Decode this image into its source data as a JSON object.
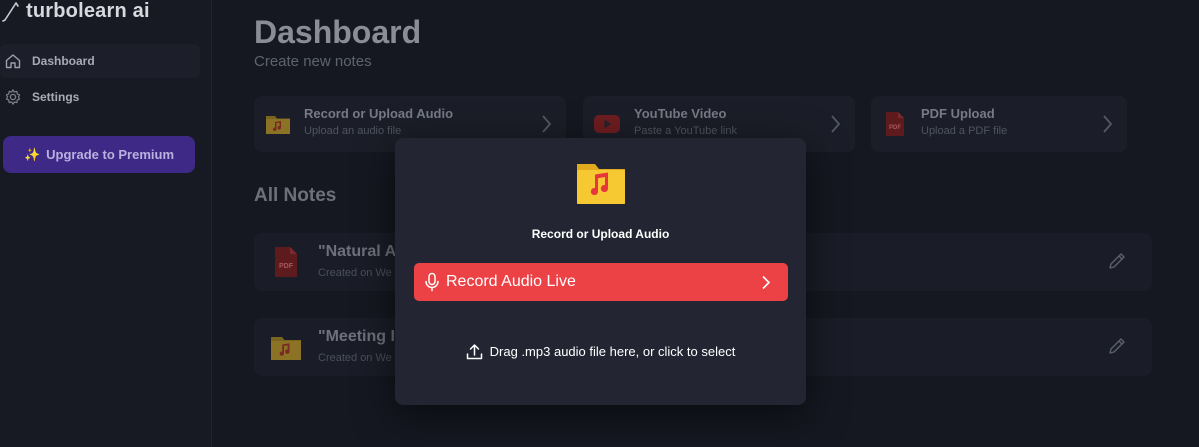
{
  "app": {
    "brand": "turbolearn ai"
  },
  "sidebar": {
    "items": [
      {
        "label": "Dashboard",
        "icon": "home-icon"
      },
      {
        "label": "Settings",
        "icon": "gear-icon"
      }
    ],
    "upgrade_label": "Upgrade to Premium",
    "upgrade_icon": "sparkle-icon"
  },
  "main": {
    "title": "Dashboard",
    "subtitle": "Create new notes",
    "cards": [
      {
        "title": "Record or Upload Audio",
        "subtitle": "Upload an audio file",
        "icon": "audio-folder-icon"
      },
      {
        "title": "YouTube Video",
        "subtitle": "Paste a YouTube link",
        "icon": "youtube-icon"
      },
      {
        "title": "PDF Upload",
        "subtitle": "Upload a PDF file",
        "icon": "pdf-icon"
      }
    ],
    "notes_title": "All Notes",
    "notes": [
      {
        "title": "\"Natural A",
        "meta": "Created on We",
        "icon": "pdf-icon"
      },
      {
        "title": "\"Meeting I",
        "meta": "Created on We",
        "icon": "audio-folder-icon"
      }
    ]
  },
  "modal": {
    "title": "Record or Upload Audio",
    "record_label": "Record Audio Live",
    "upload_text": "Drag .mp3 audio file here, or click to select"
  },
  "colors": {
    "background": "#151821",
    "accent_red": "#ec4246",
    "premium_purple": "#3e2a86",
    "folder_yellow": "#f6c932"
  }
}
